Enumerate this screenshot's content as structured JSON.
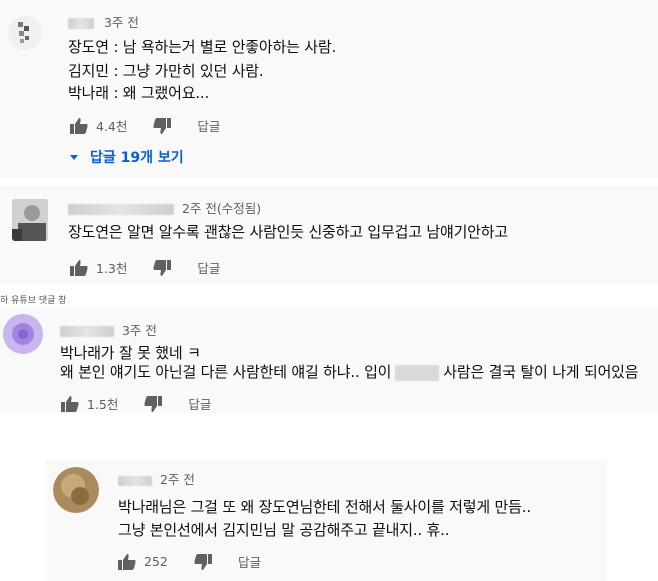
{
  "comments": [
    {
      "time": "3주 전",
      "lines": [
        "장도연 : 남 욕하는거 별로 안좋아하는 사람.",
        "김지민 : 그냥 가만히 있던 사람.",
        "박나래 : 왜 그랬어요..."
      ],
      "likes": "4.4천",
      "reply_label": "답글",
      "replies_toggle": "답글 19개 보기"
    },
    {
      "time": "2주 전(수정됨)",
      "lines": [
        "장도연은 알면 알수록 괜찮은 사람인듯 신중하고 입무겁고 남얘기안하고"
      ],
      "likes": "1.3천",
      "reply_label": "답글"
    },
    {
      "caption": "하 유튜브 댓글 창",
      "time": "3주 전",
      "lines": [
        "박나래가 잘 못 했네 ㅋ",
        "왜 본인 얘기도 아닌걸 다른 사람한테 얘길 하냐.. 입이",
        "사람은 결국 탈이 나게 되어있음"
      ],
      "likes": "1.5천",
      "reply_label": "답글"
    },
    {
      "time": "2주 전",
      "lines": [
        "박나래님은 그걸 또 왜 장도연님한테 전해서 둘사이를 저렇게 만듬..",
        "그냥 본인선에서 김지민님 말 공감해주고 끝내지.. 휴.."
      ],
      "likes": "252",
      "reply_label": "답글"
    }
  ],
  "colors": {
    "link": "#065fd4",
    "meta": "#606060",
    "card": "#f9f9f9"
  },
  "icons": [
    "thumbs-up-icon",
    "thumbs-down-icon",
    "dropdown-triangle-icon",
    "avatar"
  ]
}
